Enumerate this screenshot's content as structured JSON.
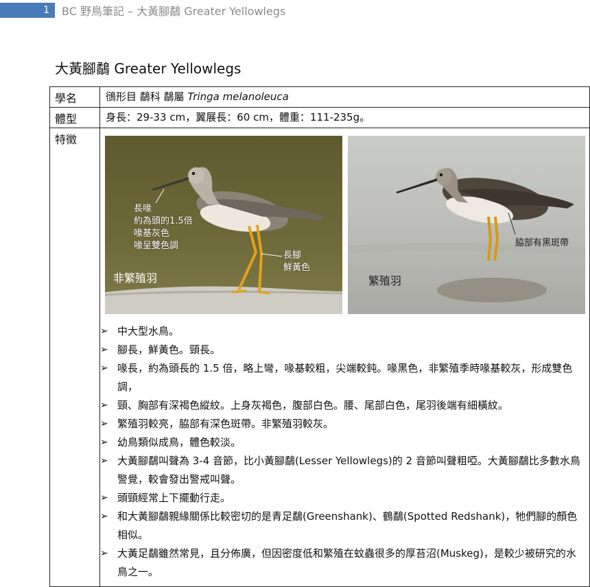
{
  "header": {
    "page_number": "1",
    "title": "BC 野鳥筆記 – 大黃腳鷸 Greater Yellowlegs"
  },
  "doc_title": "大黃腳鷸  Greater Yellowlegs",
  "rows": {
    "taxonomy": {
      "label": "學名",
      "text": "鴴形目  鷸科  鷸屬 ",
      "scientific": "Tringa melanoleuca"
    },
    "size": {
      "label": "體型",
      "text": "身長：29-33 cm，翼展長：60 cm，體重：111-235g。"
    },
    "features": {
      "label": "特徵"
    }
  },
  "photos": {
    "left": {
      "annotation_bill": [
        "長喙",
        "約為頭的1.5倍",
        "喙基灰色",
        "喙呈雙色調"
      ],
      "annotation_legs": [
        "長腳",
        "鮮黃色"
      ],
      "plumage_label": "非繁殖羽"
    },
    "right": {
      "annotation_flank": "脇部有黑斑帶",
      "plumage_label": "繁殖羽"
    }
  },
  "features": [
    "中大型水鳥。",
    "腳長，鮮黃色。頸長。",
    "喙長，約為頭長的 1.5 倍，略上彎，喙基較粗，尖端較鈍。喙黑色，非繁殖季時喙基較灰，形成雙色調，",
    "頸、胸部有深褐色縱紋。上身灰褐色，腹部白色。腰、尾部白色，尾羽後端有細橫紋。",
    "繁殖羽較亮，脇部有深色斑帶。非繁殖羽較灰。",
    "幼鳥類似成鳥，體色較淡。",
    "大黃腳鷸叫聲為 3-4 音節，比小黃腳鷸(Lesser Yellowlegs)的 2 音節叫聲粗啞。大黃腳鷸比多數水鳥警覺，較會發出警戒叫聲。",
    "頭頸經常上下擺動行走。",
    "和大黃腳鷸親緣關係比較密切的是青足鷸(Greenshank)、鶴鷸(Spotted Redshank)，牠們腳的顏色相似。",
    "大黃足鷸雖然常見，且分佈廣，但因密度低和繁殖在蚊蟲很多的厚苔沼(Muskeg)，是較少被研究的水鳥之一。"
  ],
  "bullet_glyph": "➢"
}
